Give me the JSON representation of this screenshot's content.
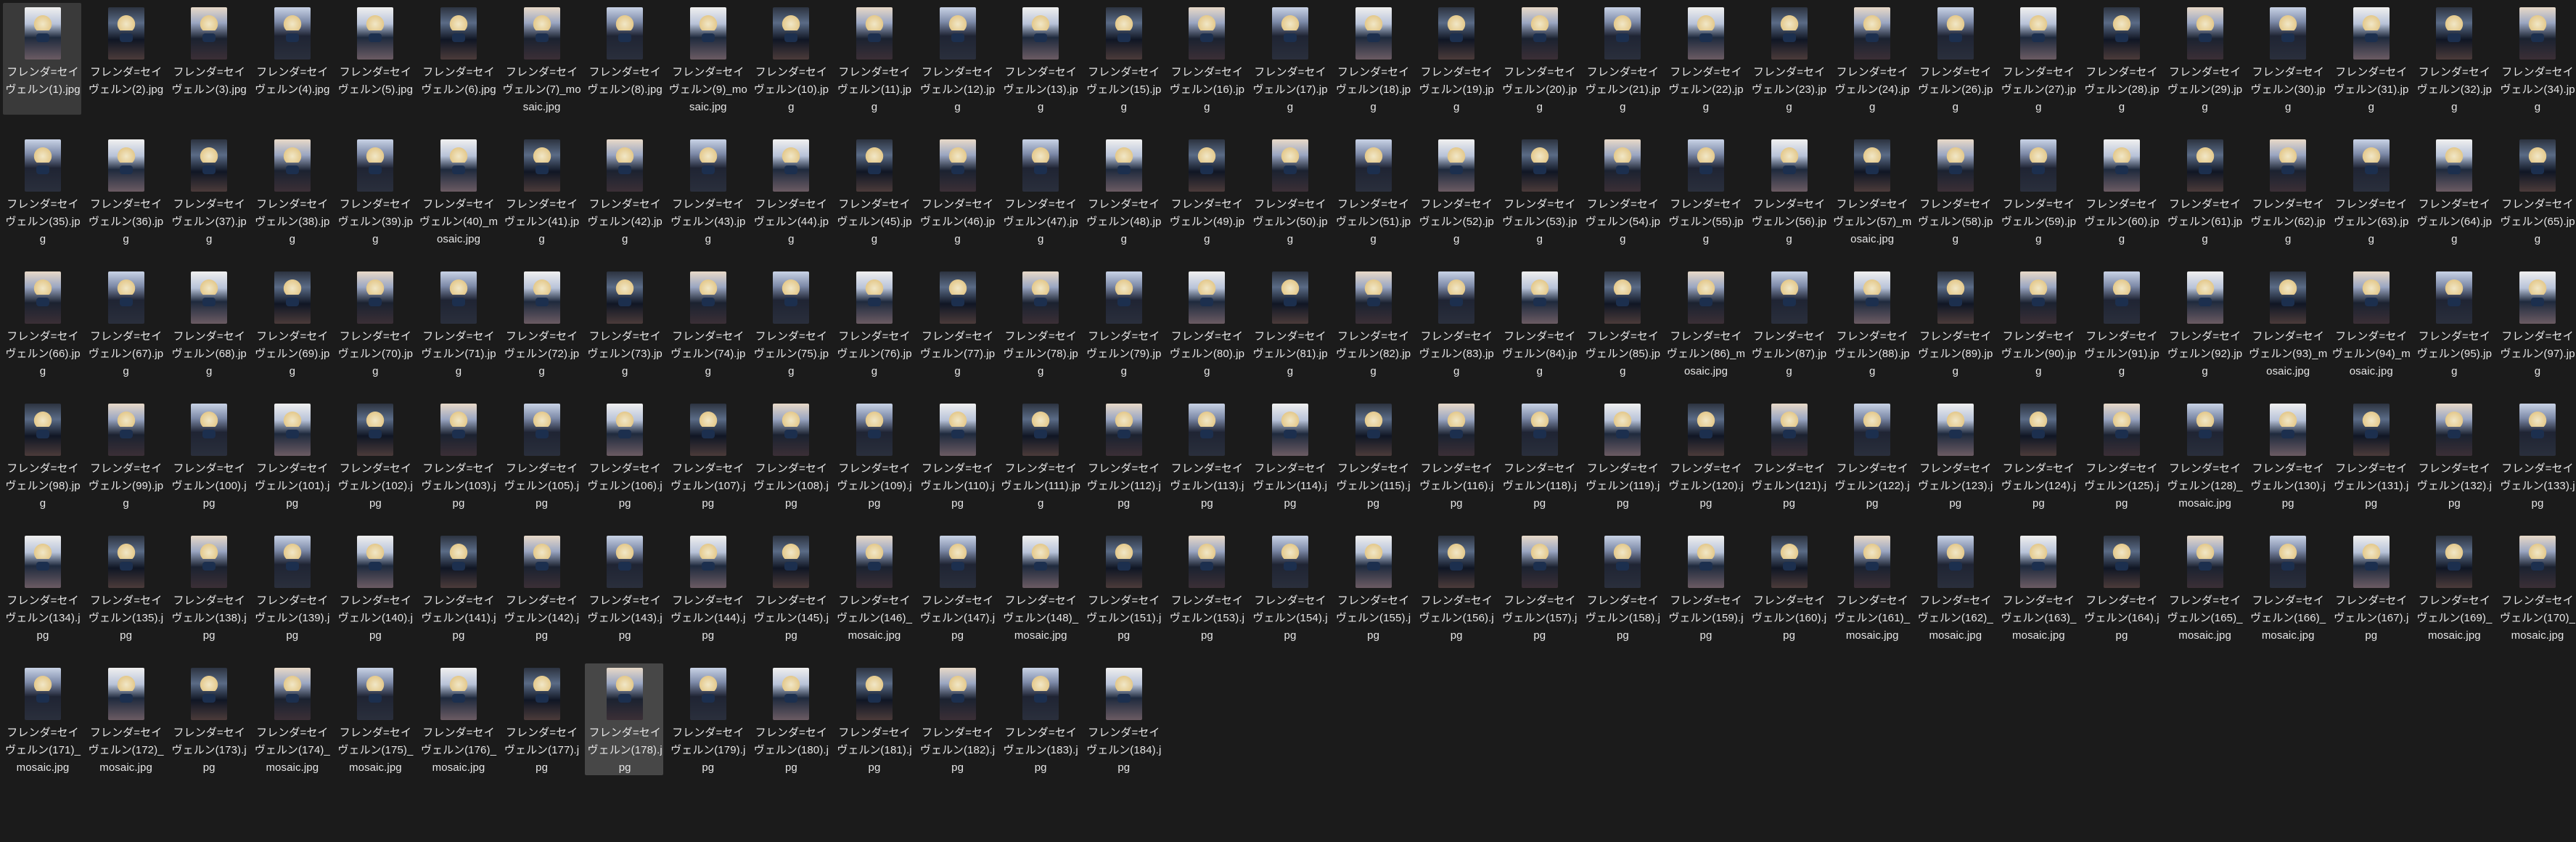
{
  "files": [
    {
      "name": "フレンダ=セイヴェルン(1).jpg",
      "selected": true
    },
    {
      "name": "フレンダ=セイヴェルン(2).jpg"
    },
    {
      "name": "フレンダ=セイヴェルン(3).jpg"
    },
    {
      "name": "フレンダ=セイヴェルン(4).jpg"
    },
    {
      "name": "フレンダ=セイヴェルン(5).jpg"
    },
    {
      "name": "フレンダ=セイヴェルン(6).jpg"
    },
    {
      "name": "フレンダ=セイヴェルン(7)_mosaic.jpg"
    },
    {
      "name": "フレンダ=セイヴェルン(8).jpg"
    },
    {
      "name": "フレンダ=セイヴェルン(9)_mosaic.jpg"
    },
    {
      "name": "フレンダ=セイヴェルン(10).jpg"
    },
    {
      "name": "フレンダ=セイヴェルン(11).jpg"
    },
    {
      "name": "フレンダ=セイヴェルン(12).jpg"
    },
    {
      "name": "フレンダ=セイヴェルン(13).jpg"
    },
    {
      "name": "フレンダ=セイヴェルン(15).jpg"
    },
    {
      "name": "フレンダ=セイヴェルン(16).jpg"
    },
    {
      "name": "フレンダ=セイヴェルン(17).jpg"
    },
    {
      "name": "フレンダ=セイヴェルン(18).jpg"
    },
    {
      "name": "フレンダ=セイヴェルン(19).jpg"
    },
    {
      "name": "フレンダ=セイヴェルン(20).jpg"
    },
    {
      "name": "フレンダ=セイヴェルン(21).jpg"
    },
    {
      "name": "フレンダ=セイヴェルン(22).jpg"
    },
    {
      "name": "フレンダ=セイヴェルン(23).jpg"
    },
    {
      "name": "フレンダ=セイヴェルン(24).jpg"
    },
    {
      "name": "フレンダ=セイヴェルン(26).jpg"
    },
    {
      "name": "フレンダ=セイヴェルン(27).jpg"
    },
    {
      "name": "フレンダ=セイヴェルン(28).jpg"
    },
    {
      "name": "フレンダ=セイヴェルン(29).jpg"
    },
    {
      "name": "フレンダ=セイヴェルン(30).jpg"
    },
    {
      "name": "フレンダ=セイヴェルン(31).jpg"
    },
    {
      "name": "フレンダ=セイヴェルン(32).jpg"
    },
    {
      "name": "フレンダ=セイヴェルン(34).jpg"
    },
    {
      "name": "フレンダ=セイヴェルン(35).jpg"
    },
    {
      "name": "フレンダ=セイヴェルン(36).jpg"
    },
    {
      "name": "フレンダ=セイヴェルン(37).jpg"
    },
    {
      "name": "フレンダ=セイヴェルン(38).jpg"
    },
    {
      "name": "フレンダ=セイヴェルン(39).jpg"
    },
    {
      "name": "フレンダ=セイヴェルン(40)_mosaic.jpg"
    },
    {
      "name": "フレンダ=セイヴェルン(41).jpg"
    },
    {
      "name": "フレンダ=セイヴェルン(42).jpg"
    },
    {
      "name": "フレンダ=セイヴェルン(43).jpg"
    },
    {
      "name": "フレンダ=セイヴェルン(44).jpg"
    },
    {
      "name": "フレンダ=セイヴェルン(45).jpg"
    },
    {
      "name": "フレンダ=セイヴェルン(46).jpg"
    },
    {
      "name": "フレンダ=セイヴェルン(47).jpg"
    },
    {
      "name": "フレンダ=セイヴェルン(48).jpg"
    },
    {
      "name": "フレンダ=セイヴェルン(49).jpg"
    },
    {
      "name": "フレンダ=セイヴェルン(50).jpg"
    },
    {
      "name": "フレンダ=セイヴェルン(51).jpg"
    },
    {
      "name": "フレンダ=セイヴェルン(52).jpg"
    },
    {
      "name": "フレンダ=セイヴェルン(53).jpg"
    },
    {
      "name": "フレンダ=セイヴェルン(54).jpg"
    },
    {
      "name": "フレンダ=セイヴェルン(55).jpg"
    },
    {
      "name": "フレンダ=セイヴェルン(56).jpg"
    },
    {
      "name": "フレンダ=セイヴェルン(57)_mosaic.jpg"
    },
    {
      "name": "フレンダ=セイヴェルン(58).jpg"
    },
    {
      "name": "フレンダ=セイヴェルン(59).jpg"
    },
    {
      "name": "フレンダ=セイヴェルン(60).jpg"
    },
    {
      "name": "フレンダ=セイヴェルン(61).jpg"
    },
    {
      "name": "フレンダ=セイヴェルン(62).jpg"
    },
    {
      "name": "フレンダ=セイヴェルン(63).jpg"
    },
    {
      "name": "フレンダ=セイヴェルン(64).jpg"
    },
    {
      "name": "フレンダ=セイヴェルン(65).jpg"
    },
    {
      "name": "フレンダ=セイヴェルン(66).jpg"
    },
    {
      "name": "フレンダ=セイヴェルン(67).jpg"
    },
    {
      "name": "フレンダ=セイヴェルン(68).jpg"
    },
    {
      "name": "フレンダ=セイヴェルン(69).jpg"
    },
    {
      "name": "フレンダ=セイヴェルン(70).jpg"
    },
    {
      "name": "フレンダ=セイヴェルン(71).jpg"
    },
    {
      "name": "フレンダ=セイヴェルン(72).jpg"
    },
    {
      "name": "フレンダ=セイヴェルン(73).jpg"
    },
    {
      "name": "フレンダ=セイヴェルン(74).jpg"
    },
    {
      "name": "フレンダ=セイヴェルン(75).jpg"
    },
    {
      "name": "フレンダ=セイヴェルン(76).jpg"
    },
    {
      "name": "フレンダ=セイヴェルン(77).jpg"
    },
    {
      "name": "フレンダ=セイヴェルン(78).jpg"
    },
    {
      "name": "フレンダ=セイヴェルン(79).jpg"
    },
    {
      "name": "フレンダ=セイヴェルン(80).jpg"
    },
    {
      "name": "フレンダ=セイヴェルン(81).jpg"
    },
    {
      "name": "フレンダ=セイヴェルン(82).jpg"
    },
    {
      "name": "フレンダ=セイヴェルン(83).jpg"
    },
    {
      "name": "フレンダ=セイヴェルン(84).jpg"
    },
    {
      "name": "フレンダ=セイヴェルン(85).jpg"
    },
    {
      "name": "フレンダ=セイヴェルン(86)_mosaic.jpg"
    },
    {
      "name": "フレンダ=セイヴェルン(87).jpg"
    },
    {
      "name": "フレンダ=セイヴェルン(88).jpg"
    },
    {
      "name": "フレンダ=セイヴェルン(89).jpg"
    },
    {
      "name": "フレンダ=セイヴェルン(90).jpg"
    },
    {
      "name": "フレンダ=セイヴェルン(91).jpg"
    },
    {
      "name": "フレンダ=セイヴェルン(92).jpg"
    },
    {
      "name": "フレンダ=セイヴェルン(93)_mosaic.jpg"
    },
    {
      "name": "フレンダ=セイヴェルン(94)_mosaic.jpg"
    },
    {
      "name": "フレンダ=セイヴェルン(95).jpg"
    },
    {
      "name": "フレンダ=セイヴェルン(97).jpg"
    },
    {
      "name": "フレンダ=セイヴェルン(98).jpg"
    },
    {
      "name": "フレンダ=セイヴェルン(99).jpg"
    },
    {
      "name": "フレンダ=セイヴェルン(100).jpg"
    },
    {
      "name": "フレンダ=セイヴェルン(101).jpg"
    },
    {
      "name": "フレンダ=セイヴェルン(102).jpg"
    },
    {
      "name": "フレンダ=セイヴェルン(103).jpg"
    },
    {
      "name": "フレンダ=セイヴェルン(105).jpg"
    },
    {
      "name": "フレンダ=セイヴェルン(106).jpg"
    },
    {
      "name": "フレンダ=セイヴェルン(107).jpg"
    },
    {
      "name": "フレンダ=セイヴェルン(108).jpg"
    },
    {
      "name": "フレンダ=セイヴェルン(109).jpg"
    },
    {
      "name": "フレンダ=セイヴェルン(110).jpg"
    },
    {
      "name": "フレンダ=セイヴェルン(111).jpg"
    },
    {
      "name": "フレンダ=セイヴェルン(112).jpg"
    },
    {
      "name": "フレンダ=セイヴェルン(113).jpg"
    },
    {
      "name": "フレンダ=セイヴェルン(114).jpg"
    },
    {
      "name": "フレンダ=セイヴェルン(115).jpg"
    },
    {
      "name": "フレンダ=セイヴェルン(116).jpg"
    },
    {
      "name": "フレンダ=セイヴェルン(118).jpg"
    },
    {
      "name": "フレンダ=セイヴェルン(119).jpg"
    },
    {
      "name": "フレンダ=セイヴェルン(120).jpg"
    },
    {
      "name": "フレンダ=セイヴェルン(121).jpg"
    },
    {
      "name": "フレンダ=セイヴェルン(122).jpg"
    },
    {
      "name": "フレンダ=セイヴェルン(123).jpg"
    },
    {
      "name": "フレンダ=セイヴェルン(124).jpg"
    },
    {
      "name": "フレンダ=セイヴェルン(125).jpg"
    },
    {
      "name": "フレンダ=セイヴェルン(128)_mosaic.jpg"
    },
    {
      "name": "フレンダ=セイヴェルン(130).jpg"
    },
    {
      "name": "フレンダ=セイヴェルン(131).jpg"
    },
    {
      "name": "フレンダ=セイヴェルン(132).jpg"
    },
    {
      "name": "フレンダ=セイヴェルン(133).jpg"
    },
    {
      "name": "フレンダ=セイヴェルン(134).jpg"
    },
    {
      "name": "フレンダ=セイヴェルン(135).jpg"
    },
    {
      "name": "フレンダ=セイヴェルン(138).jpg"
    },
    {
      "name": "フレンダ=セイヴェルン(139).jpg"
    },
    {
      "name": "フレンダ=セイヴェルン(140).jpg"
    },
    {
      "name": "フレンダ=セイヴェルン(141).jpg"
    },
    {
      "name": "フレンダ=セイヴェルン(142).jpg"
    },
    {
      "name": "フレンダ=セイヴェルン(143).jpg"
    },
    {
      "name": "フレンダ=セイヴェルン(144).jpg"
    },
    {
      "name": "フレンダ=セイヴェルン(145).jpg"
    },
    {
      "name": "フレンダ=セイヴェルン(146)_mosaic.jpg"
    },
    {
      "name": "フレンダ=セイヴェルン(147).jpg"
    },
    {
      "name": "フレンダ=セイヴェルン(148)_mosaic.jpg"
    },
    {
      "name": "フレンダ=セイヴェルン(151).jpg"
    },
    {
      "name": "フレンダ=セイヴェルン(153).jpg"
    },
    {
      "name": "フレンダ=セイヴェルン(154).jpg"
    },
    {
      "name": "フレンダ=セイヴェルン(155).jpg"
    },
    {
      "name": "フレンダ=セイヴェルン(156).jpg"
    },
    {
      "name": "フレンダ=セイヴェルン(157).jpg"
    },
    {
      "name": "フレンダ=セイヴェルン(158).jpg"
    },
    {
      "name": "フレンダ=セイヴェルン(159).jpg"
    },
    {
      "name": "フレンダ=セイヴェルン(160).jpg"
    },
    {
      "name": "フレンダ=セイヴェルン(161)_mosaic.jpg"
    },
    {
      "name": "フレンダ=セイヴェルン(162)_mosaic.jpg"
    },
    {
      "name": "フレンダ=セイヴェルン(163)_mosaic.jpg"
    },
    {
      "name": "フレンダ=セイヴェルン(164).jpg"
    },
    {
      "name": "フレンダ=セイヴェルン(165)_mosaic.jpg"
    },
    {
      "name": "フレンダ=セイヴェルン(166)_mosaic.jpg"
    },
    {
      "name": "フレンダ=セイヴェルン(167).jpg"
    },
    {
      "name": "フレンダ=セイヴェルン(169)_mosaic.jpg"
    },
    {
      "name": "フレンダ=セイヴェルン(170)_mosaic.jpg"
    },
    {
      "name": "フレンダ=セイヴェルン(171)_mosaic.jpg"
    },
    {
      "name": "フレンダ=セイヴェルン(172)_mosaic.jpg"
    },
    {
      "name": "フレンダ=セイヴェルン(173).jpg"
    },
    {
      "name": "フレンダ=セイヴェルン(174)_mosaic.jpg"
    },
    {
      "name": "フレンダ=セイヴェルン(175)_mosaic.jpg"
    },
    {
      "name": "フレンダ=セイヴェルン(176)_mosaic.jpg"
    },
    {
      "name": "フレンダ=セイヴェルン(177).jpg"
    },
    {
      "name": "フレンダ=セイヴェルン(178).jpg",
      "focused": true
    },
    {
      "name": "フレンダ=セイヴェルン(179).jpg"
    },
    {
      "name": "フレンダ=セイヴェルン(180).jpg"
    },
    {
      "name": "フレンダ=セイヴェルン(181).jpg"
    },
    {
      "name": "フレンダ=セイヴェルン(182).jpg"
    },
    {
      "name": "フレンダ=セイヴェルン(183).jpg"
    },
    {
      "name": "フレンダ=セイヴェルン(184).jpg"
    }
  ]
}
